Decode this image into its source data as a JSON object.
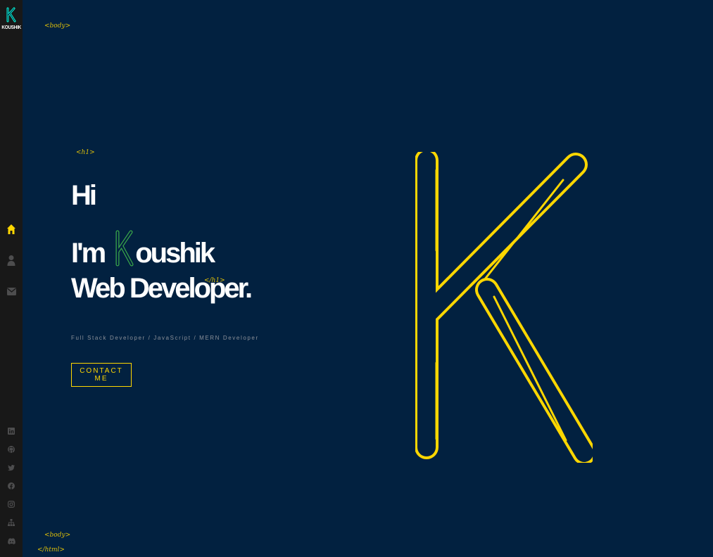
{
  "brand": {
    "logo_text": "KOUSHIK"
  },
  "tags": {
    "body_open": "<body>",
    "h1_open": "<h1>",
    "h1_close": "</h1>",
    "body_close": "<body>",
    "html_close": "</html>"
  },
  "hero": {
    "line1": "Hi",
    "line2_prefix": "I'm",
    "line2_suffix": "oushik",
    "line3": "Web Developer.",
    "subtitle": "Full Stack Developer / JavaScript / MERN Developer",
    "cta": "CONTACT ME"
  },
  "nav": {
    "items": [
      {
        "icon": "home-icon",
        "active": true
      },
      {
        "icon": "user-icon",
        "active": false
      },
      {
        "icon": "envelope-icon",
        "active": false
      }
    ]
  },
  "social": {
    "items": [
      "linkedin-icon",
      "github-icon",
      "twitter-icon",
      "facebook-icon",
      "instagram-icon",
      "sitemap-icon",
      "discord-icon"
    ]
  },
  "colors": {
    "background": "#022140",
    "sidebar": "#181818",
    "accent": "#ffd700",
    "brand_k": "#08fdd8",
    "text": "#ffffff",
    "muted": "#8a8f98"
  }
}
